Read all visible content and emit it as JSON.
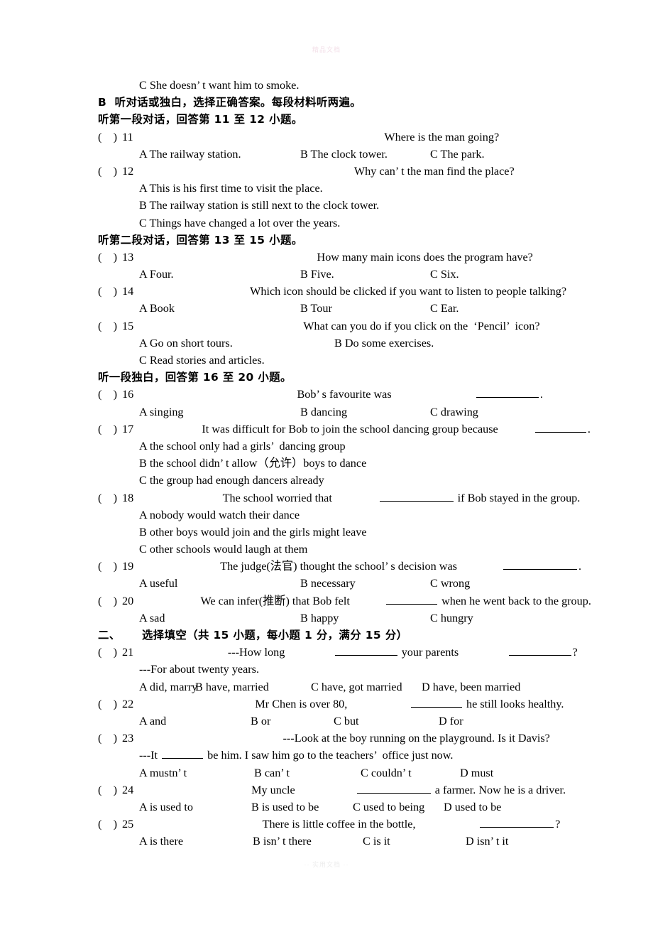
{
  "document": {
    "watermark_top": "精品文档",
    "watermark_bottom": "·· 实用文档 ··"
  },
  "carryover_option": "C She doesn’ t want him to smoke.",
  "section_b": {
    "heading": "B  听对话或独白，选择正确答案。每段材料听两遍。",
    "groups": [
      {
        "heading": "听第一段对话，回答第 11 至 12 小题。",
        "questions": [
          {
            "paren": "(    )",
            "number": "11",
            "stem": "Where is the man going?",
            "layout": "row",
            "options": [
              "A The railway station.",
              "B The clock tower.",
              "C The park."
            ]
          },
          {
            "paren": "(    )",
            "number": "12",
            "stem": "Why can’ t the man find the place?",
            "layout": "stack",
            "options": [
              "A This is his first time to visit the place.",
              "B The railway station is still next to the clock tower.",
              "C Things have changed a lot over the years."
            ]
          }
        ]
      },
      {
        "heading": "听第二段对话，回答第 13 至 15 小题。",
        "questions": [
          {
            "paren": "(    )",
            "number": "13",
            "stem": "How many main icons does the program have?",
            "layout": "row",
            "options": [
              "A Four.",
              "B Five.",
              "C Six."
            ]
          },
          {
            "paren": "(    )",
            "number": "14",
            "stem": "Which icon should be clicked if you want to listen to people talking?",
            "layout": "row",
            "options": [
              "A Book",
              "B Tour",
              "C Ear."
            ]
          },
          {
            "paren": "(    )",
            "number": "15",
            "stem": "What can you do if you click on the  ‘Pencil’  icon?",
            "layout": "two-then-one",
            "options": [
              "A Go on short tours.",
              "B Do some exercises.",
              "C Read stories and articles."
            ]
          }
        ]
      },
      {
        "heading": "听一段独白，回答第 16 至 20 小题。",
        "questions": [
          {
            "paren": "(    )",
            "number": "16",
            "stem_pre": "Bob’ s favourite was ",
            "stem_post": ".",
            "blank": "b-lg",
            "layout": "row",
            "options": [
              "A singing",
              "B dancing",
              "C drawing"
            ]
          },
          {
            "paren": "(    )",
            "number": "17",
            "stem_pre": "It was difficult for Bob to join the school dancing group because ",
            "stem_post": ".",
            "blank": "b-md",
            "layout": "stack",
            "options": [
              "A the school only had a girls’  dancing group",
              "B the school didn’ t allow（允许）boys to dance",
              "C the group had enough dancers already"
            ]
          },
          {
            "paren": "(    )",
            "number": "18",
            "stem_pre": "The school worried that ",
            "stem_post": " if Bob stayed in the group.",
            "blank": "b-xl",
            "layout": "stack",
            "options": [
              "A nobody would watch their dance",
              "B other boys would join and the girls might leave",
              "C other schools would laugh at them"
            ]
          },
          {
            "paren": "(    )",
            "number": "19",
            "stem_pre": "The judge(法官) thought the school’ s decision was ",
            "stem_post": ".",
            "blank": "b-xl",
            "layout": "row",
            "options": [
              "A useful",
              "B necessary",
              "C wrong"
            ]
          },
          {
            "paren": "(    )",
            "number": "20",
            "stem_pre": "We can infer(推断) that Bob felt ",
            "stem_post": " when he went back to the group.",
            "blank": "b-md",
            "layout": "row",
            "options": [
              "A sad",
              "B happy",
              "C hungry"
            ]
          }
        ]
      }
    ]
  },
  "section_two": {
    "number": "二、",
    "title": "选择填空（共 15 小题，每小题 1 分，满分 15 分）",
    "questions": [
      {
        "paren": "(    )",
        "number": "21",
        "stem_pre": "---How long ",
        "stem_mid": " your parents ",
        "stem_post": "?",
        "reply": "---For about twenty years.",
        "options": [
          "A did, marry",
          "B have, married",
          "C have, got married",
          "D have, been married"
        ]
      },
      {
        "paren": "(    )",
        "number": "22",
        "stem_pre": "Mr Chen is over 80, ",
        "stem_post": " he still looks healthy.",
        "options": [
          "A and",
          "B or",
          "C but",
          "D for"
        ]
      },
      {
        "paren": "(    )",
        "number": "23",
        "stem": "---Look at the boy running on the playground. Is it Davis?",
        "reply_pre": "---It ",
        "reply_post": " be him. I saw him go to the teachers’  office just now.",
        "options": [
          "A mustn’ t",
          "B can’ t",
          "C couldn’ t",
          "D must"
        ]
      },
      {
        "paren": "(    )",
        "number": "24",
        "stem_pre": "My uncle ",
        "stem_post": " a farmer. Now he is a driver.",
        "options": [
          "A is used to",
          "B is used to be",
          "C used to being",
          "D used to be"
        ]
      },
      {
        "paren": "(    )",
        "number": "25",
        "stem_pre": "There is little coffee in the bottle,",
        "stem_post": "?",
        "options": [
          "A is there",
          "B isn’ t there",
          "C is it",
          "D isn’ t it"
        ]
      }
    ]
  }
}
